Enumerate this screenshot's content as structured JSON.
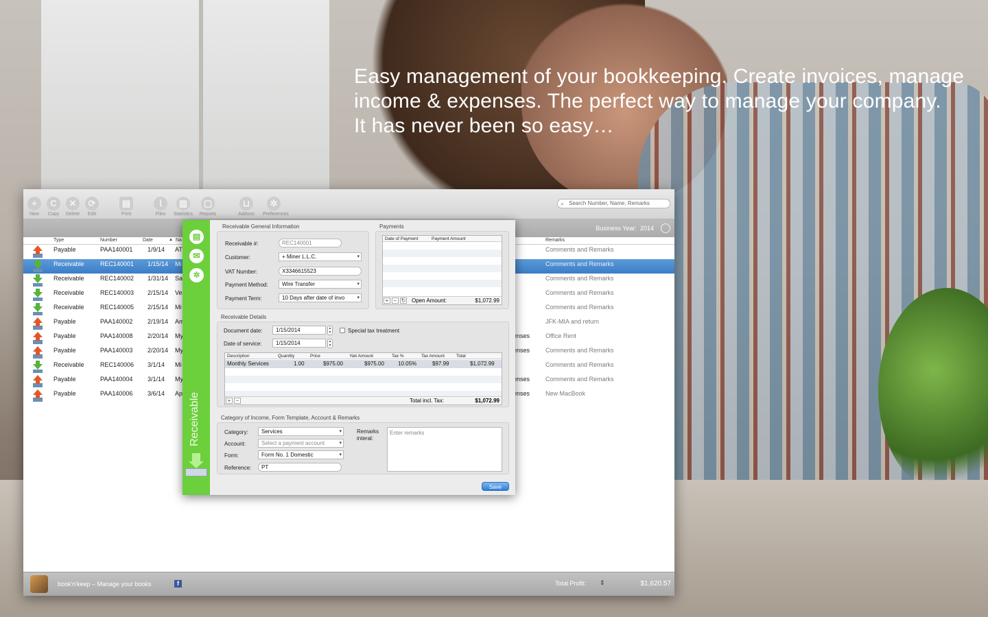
{
  "headline": {
    "line1": "Easy management of your bookkeeping. Create invoices, manage",
    "line2": "income & expenses. The perfect way to manage your company.",
    "line3": "It has never been so easy…"
  },
  "toolbar": {
    "items": [
      {
        "label": "New",
        "icon": "plus-icon",
        "glyph": "+"
      },
      {
        "label": "Copy",
        "icon": "copy-icon",
        "glyph": "C"
      },
      {
        "label": "Delete",
        "icon": "delete-icon",
        "glyph": "✕"
      },
      {
        "label": "Edit",
        "icon": "edit-icon",
        "glyph": "⟳"
      },
      {
        "label": "Print",
        "icon": "printer-icon",
        "glyph": "▤"
      },
      {
        "label": "Files",
        "icon": "paperclip-icon",
        "glyph": "⌇"
      },
      {
        "label": "Statistics",
        "icon": "chart-icon",
        "glyph": "▥"
      },
      {
        "label": "Reports",
        "icon": "speech-icon",
        "glyph": "▢"
      },
      {
        "label": "Addons",
        "icon": "cart-icon",
        "glyph": "⊔"
      },
      {
        "label": "Preferences",
        "icon": "gear-icon",
        "glyph": "✲"
      }
    ],
    "search_placeholder": "Search Number, Name, Remarks"
  },
  "subbar": {
    "business_year_label": "Business Year:",
    "business_year": "2014"
  },
  "columns": {
    "type": "Type",
    "number": "Number",
    "date": "Date",
    "name": "Na",
    "remarks": "Remarks"
  },
  "rows": [
    {
      "dir": "up",
      "type": "Payable",
      "number": "PAA140001",
      "date": "1/9/14",
      "name": "AT",
      "cat": "",
      "remarks": "Comments and Remarks",
      "selected": false
    },
    {
      "dir": "dn",
      "type": "Receivable",
      "number": "REC140001",
      "date": "1/15/14",
      "name": "Mi",
      "cat": "",
      "remarks": "Comments and Remarks",
      "selected": true
    },
    {
      "dir": "dn",
      "type": "Receivable",
      "number": "REC140002",
      "date": "1/31/14",
      "name": "Sa",
      "cat": "",
      "remarks": "Comments and Remarks",
      "selected": false
    },
    {
      "dir": "dn",
      "type": "Receivable",
      "number": "REC140003",
      "date": "2/15/14",
      "name": "Ve",
      "cat": "",
      "remarks": "Comments and Remarks",
      "selected": false
    },
    {
      "dir": "dn",
      "type": "Receivable",
      "number": "REC140005",
      "date": "2/15/14",
      "name": "Mi",
      "cat": "",
      "remarks": "Comments and Remarks",
      "selected": false
    },
    {
      "dir": "up",
      "type": "Payable",
      "number": "PAA140002",
      "date": "2/19/14",
      "name": "Am",
      "cat": "",
      "remarks": "JFK-MIA and return",
      "selected": false
    },
    {
      "dir": "up",
      "type": "Payable",
      "number": "PAA140008",
      "date": "2/20/14",
      "name": "My",
      "cat": "enses",
      "remarks": "Office Rent",
      "selected": false
    },
    {
      "dir": "up",
      "type": "Payable",
      "number": "PAA140003",
      "date": "2/20/14",
      "name": "My",
      "cat": "enses",
      "remarks": "Comments and Remarks",
      "selected": false
    },
    {
      "dir": "dn",
      "type": "Receivable",
      "number": "REC140006",
      "date": "3/1/14",
      "name": "Mi",
      "cat": "",
      "remarks": "Comments and Remarks",
      "selected": false
    },
    {
      "dir": "up",
      "type": "Payable",
      "number": "PAA140004",
      "date": "3/1/14",
      "name": "My",
      "cat": "enses",
      "remarks": "Comments and Remarks",
      "selected": false
    },
    {
      "dir": "up",
      "type": "Payable",
      "number": "PAA140006",
      "date": "3/6/14",
      "name": "Ap",
      "cat": "enses",
      "remarks": "New MacBook",
      "selected": false
    }
  ],
  "footer": {
    "app_name": "book'n'keep – Manage your books",
    "fb": "f",
    "total_label": "Total Profit:",
    "total_value": "$1,620.57"
  },
  "dialog": {
    "side_label": "Receivable",
    "general": {
      "title": "Receivable General Information",
      "receivable_label": "Receivable #:",
      "receivable_value": "REC140001",
      "customer_label": "Customer:",
      "customer_value": "Miner L.L.C.",
      "vat_label": "VAT Number:",
      "vat_value": "X3346615523",
      "method_label": "Payment Method:",
      "method_value": "Wire Transfer",
      "term_label": "Payment Term:",
      "term_value": "10 Days after date of invo"
    },
    "payments": {
      "title": "Payments",
      "col_date": "Date of Payment",
      "col_amount": "Payment Amount",
      "open_label": "Open Amount:",
      "open_value": "$1,072.99"
    },
    "details": {
      "title": "Receivable Details",
      "doc_date_label": "Document date:",
      "doc_date": "1/15/2014",
      "service_label": "Date of service:",
      "service_date": "1/15/2014",
      "special_label": "Special tax treatment",
      "cols": {
        "desc": "Description",
        "qty": "Quantity",
        "price": "Price",
        "net": "Net Amount",
        "tax": "Tax %",
        "taxamt": "Tax Amount",
        "total": "Total"
      },
      "item": {
        "desc": "Monthly Services",
        "qty": "1.00",
        "price": "$975.00",
        "net": "$975.00",
        "tax": "10.05%",
        "taxamt": "$97.99",
        "total": "$1,072.99"
      },
      "total_label": "Total incl. Tax:",
      "total_value": "$1,072.99"
    },
    "category": {
      "title": "Category of Income, Form Template, Account & Remarks",
      "cat_label": "Category:",
      "cat_value": "Services",
      "acc_label": "Account:",
      "acc_placeholder": "Select a payment account",
      "form_label": "Form:",
      "form_value": "Form No. 1 Domestic",
      "ref_label": "Reference:",
      "ref_value": "PT",
      "remarks_label1": "Remarks",
      "remarks_label2": "interal:",
      "remarks_placeholder": "Enter remarks"
    },
    "save_label": "Save"
  }
}
